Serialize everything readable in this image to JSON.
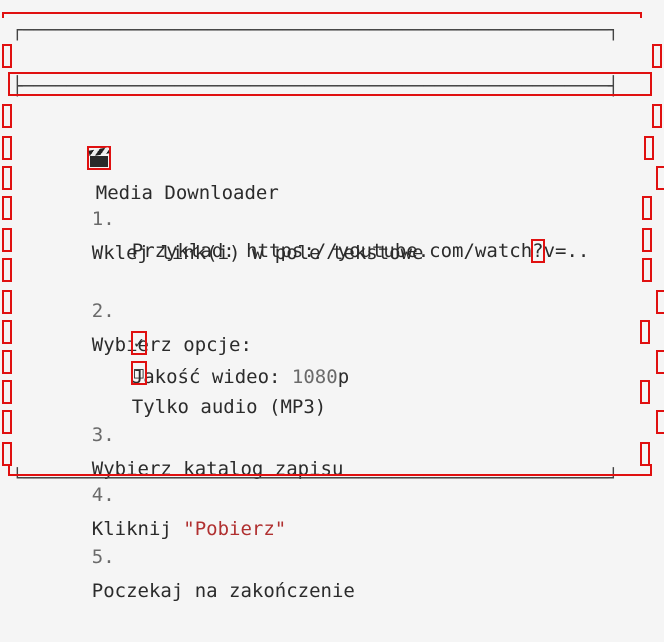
{
  "window": {
    "title": "Media Downloader",
    "title_icon": "clapperboard-icon"
  },
  "steps": [
    {
      "number": "1.",
      "text": "Wklej link(i) w pole tekstowe",
      "example_prefix": "Przykład: https://youtube.com/watch",
      "example_mark": "?",
      "example_suffix": "v=.."
    },
    {
      "number": "2.",
      "text": "Wybierz opcje:",
      "options": [
        {
          "mark": "✓",
          "label_pre": "Jakość wideo: ",
          "value": "1080",
          "label_post": "p",
          "checked": true
        },
        {
          "mark": "□",
          "label_pre": "Tylko audio (MP3)",
          "value": "",
          "label_post": "",
          "checked": false
        }
      ]
    },
    {
      "number": "3.",
      "text": "Wybierz katalog zapisu"
    },
    {
      "number": "4.",
      "text_pre": "Kliknij ",
      "text_quoted": "\"Pobierz\""
    },
    {
      "number": "5.",
      "text": "Poczekaj na zakończenie"
    }
  ],
  "colors": {
    "frame": "#444444",
    "accent": "#b03030",
    "highlight_box": "#e01010"
  }
}
